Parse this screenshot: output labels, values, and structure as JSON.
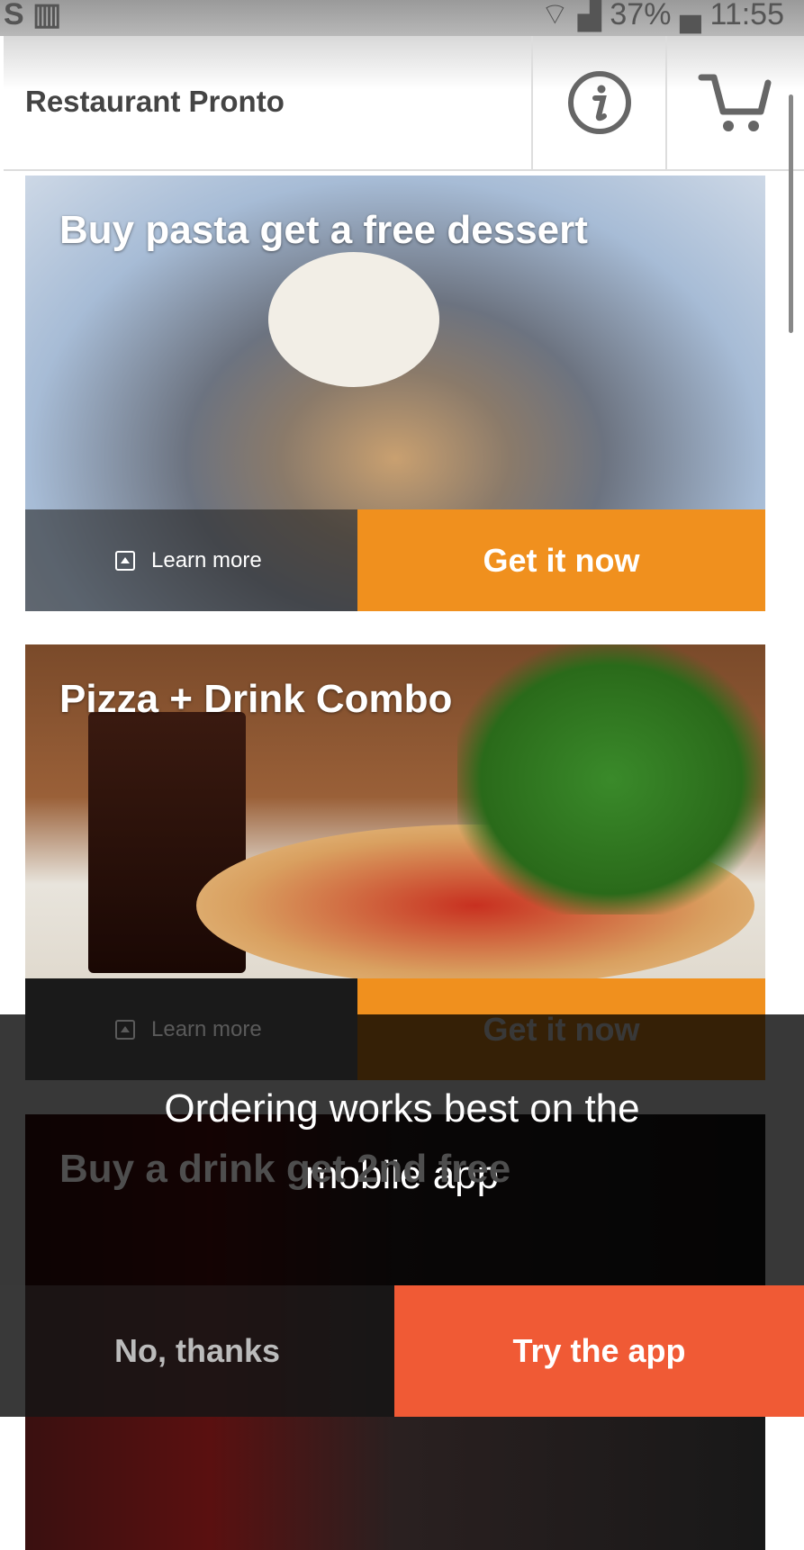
{
  "status_bar": {
    "battery": "37%",
    "time": "11:55"
  },
  "header": {
    "title": "Restaurant Pronto",
    "info_icon": "info-icon",
    "cart_icon": "cart-icon"
  },
  "cards": [
    {
      "title": "Buy pasta get a free dessert",
      "learn_more": "Learn more",
      "cta": "Get it now"
    },
    {
      "title": "Pizza + Drink Combo",
      "learn_more": "Learn more",
      "cta": "Get it now"
    },
    {
      "title": "Buy a drink get 2nd free"
    }
  ],
  "app_prompt": {
    "message": "Ordering works best on the mobile app",
    "dismiss": "No, thanks",
    "accept": "Try the app"
  },
  "colors": {
    "cta": "#f0901e",
    "accept": "#f05a35"
  }
}
